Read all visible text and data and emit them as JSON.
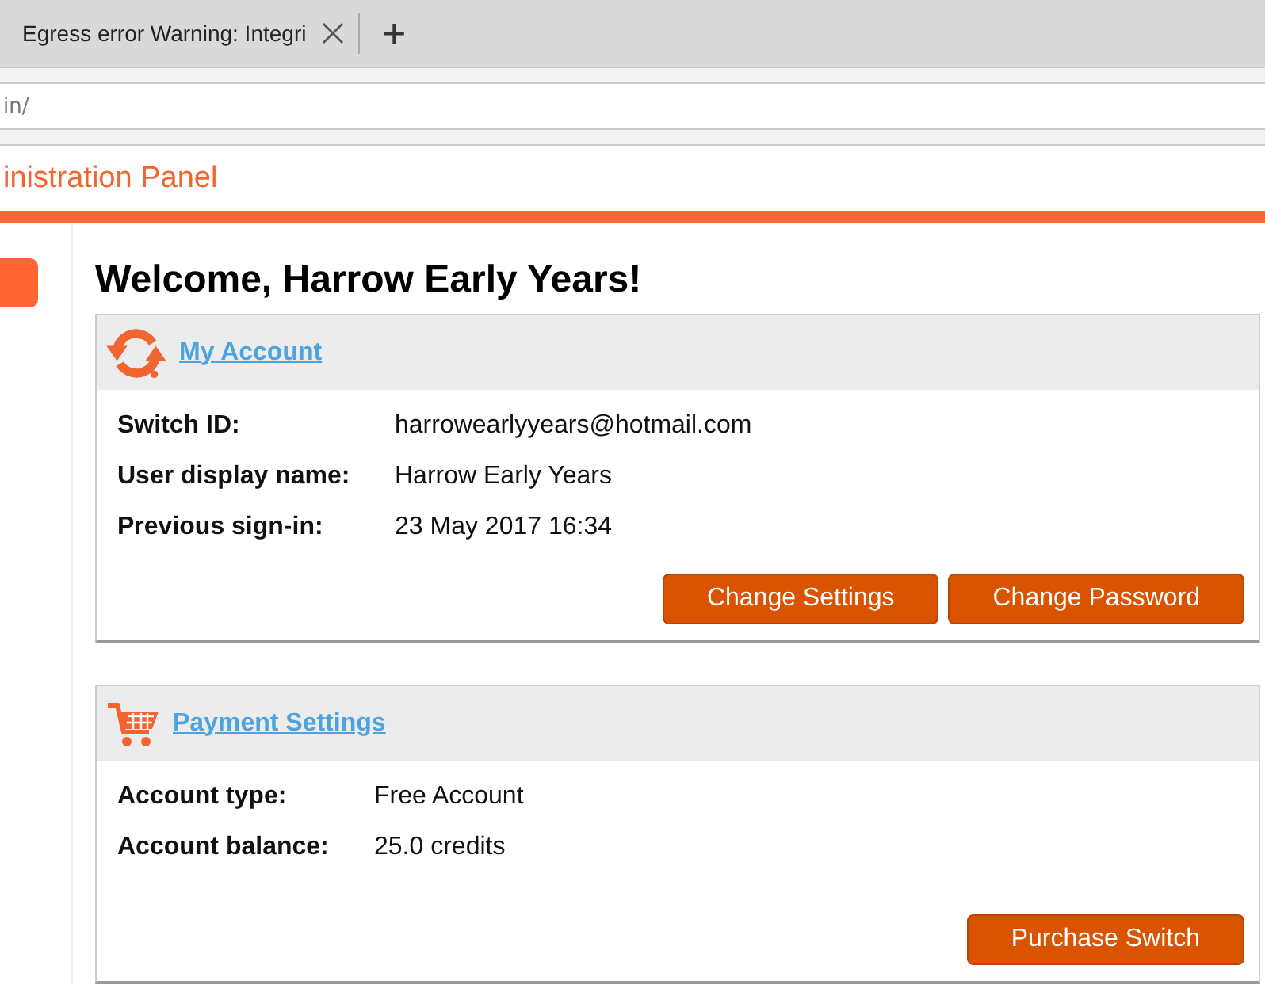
{
  "browser": {
    "tab_title": "Egress error Warning: Integri",
    "new_tab": "+",
    "address": "in/"
  },
  "header": {
    "title": "inistration Panel"
  },
  "welcome": "Welcome, Harrow Early Years!",
  "panels": [
    {
      "kind": "account",
      "title": "My Account",
      "fields": [
        {
          "label": "Switch ID:",
          "value": "harrowearlyyears@hotmail.com"
        },
        {
          "label": "User display name:",
          "value": "Harrow Early Years"
        },
        {
          "label": "Previous sign-in:",
          "value": "23 May 2017 16:34"
        }
      ],
      "buttons": [
        "Change Settings",
        "Change Password"
      ]
    },
    {
      "kind": "payment",
      "title": "Payment Settings",
      "fields": [
        {
          "label": "Account type:",
          "value": "Free Account"
        },
        {
          "label": "Account balance:",
          "value": "25.0 credits"
        }
      ],
      "buttons": [
        "Purchase Switch"
      ]
    }
  ]
}
